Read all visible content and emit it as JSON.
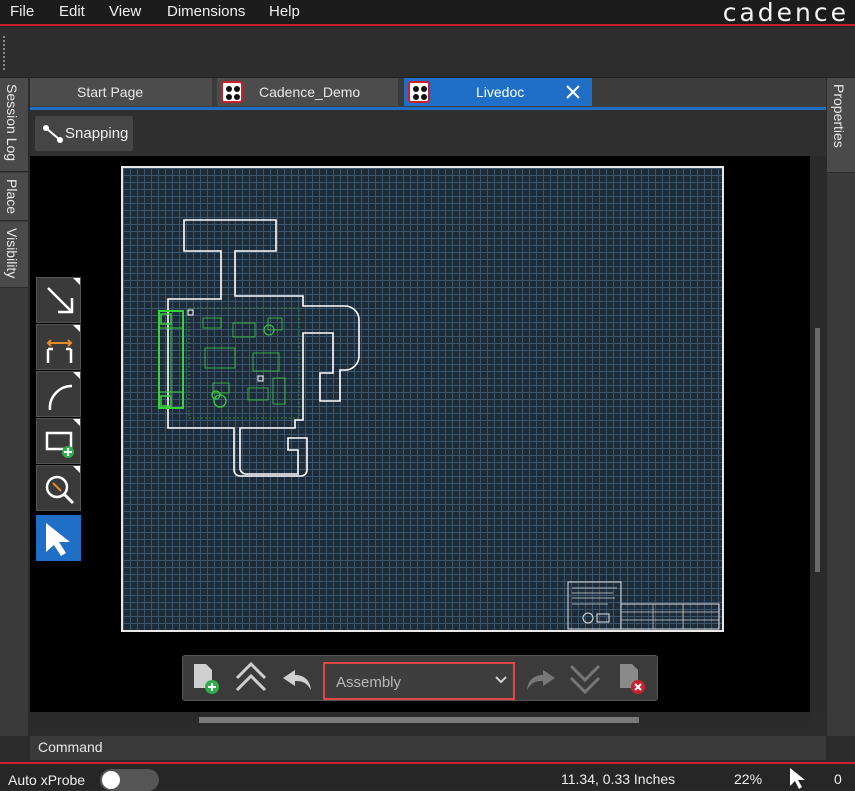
{
  "menu": {
    "file": "File",
    "edit": "Edit",
    "view": "View",
    "dimensions": "Dimensions",
    "help": "Help"
  },
  "brand": {
    "logo_text": "cadence"
  },
  "side_tabs_left": {
    "session_log": "Session Log",
    "place": "Place",
    "visibility": "Visibility"
  },
  "side_tabs_right": {
    "properties": "Properties"
  },
  "tabs": {
    "start_page": "Start Page",
    "cadence_demo": "Cadence_Demo",
    "livedoc": "Livedoc"
  },
  "toolbar": {
    "snapping": "Snapping"
  },
  "tools": [
    "arrow-line",
    "dimension",
    "arc",
    "add-view",
    "zoom",
    "select"
  ],
  "sheet_nav": {
    "layer_value": "Assembly"
  },
  "command": {
    "label": "Command"
  },
  "status": {
    "auto_xprobe": "Auto xProbe",
    "auto_xprobe_on": false,
    "coords": "11.34, 0.33 Inches",
    "zoom": "22%",
    "count": "0"
  },
  "colors": {
    "accent": "#1f6fc6",
    "brand_red": "#c8202f",
    "board_outline": "#ffffff",
    "highlight_green": "#3ad13a",
    "grid": "#3b556d"
  }
}
